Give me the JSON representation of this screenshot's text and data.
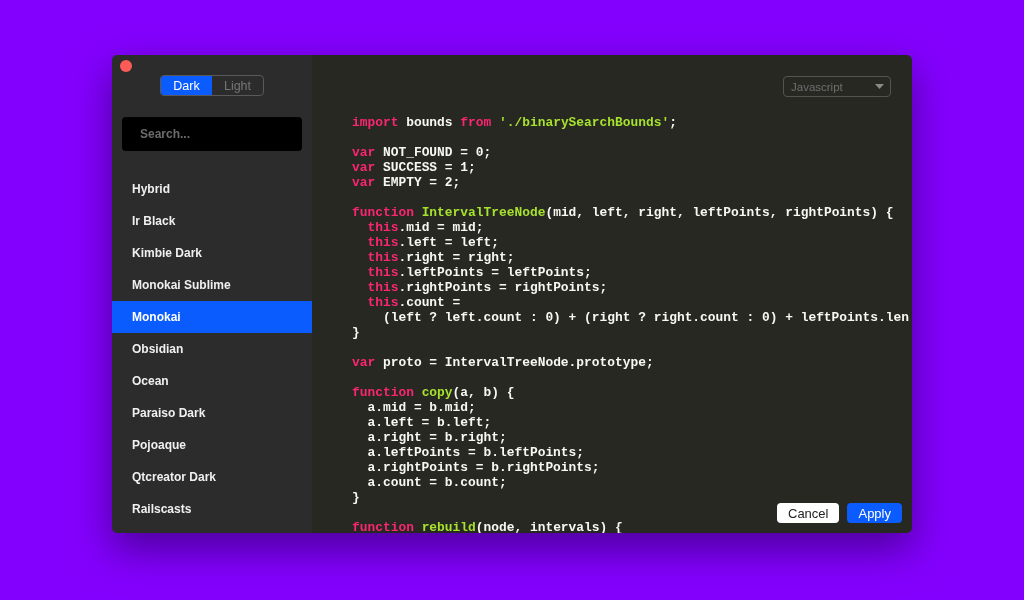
{
  "sidebar": {
    "theme_toggle": [
      {
        "label": "Dark",
        "selected": true
      },
      {
        "label": "Light",
        "selected": false
      }
    ],
    "search": {
      "placeholder": "Search..."
    },
    "items": [
      {
        "label": "Hybrid",
        "selected": false
      },
      {
        "label": "Ir Black",
        "selected": false
      },
      {
        "label": "Kimbie Dark",
        "selected": false
      },
      {
        "label": "Monokai Sublime",
        "selected": false
      },
      {
        "label": "Monokai",
        "selected": true
      },
      {
        "label": "Obsidian",
        "selected": false
      },
      {
        "label": "Ocean",
        "selected": false
      },
      {
        "label": "Paraiso Dark",
        "selected": false
      },
      {
        "label": "Pojoaque",
        "selected": false
      },
      {
        "label": "Qtcreator Dark",
        "selected": false
      },
      {
        "label": "Railscasts",
        "selected": false
      }
    ]
  },
  "editor": {
    "language_select": {
      "value": "Javascript"
    },
    "code_blocks": [
      [
        {
          "tokens": [
            {
              "kind": "keyword",
              "text": "import"
            },
            {
              "kind": "plain",
              "text": " bounds "
            },
            {
              "kind": "keyword",
              "text": "from"
            },
            {
              "kind": "string",
              "text": " './binarySearchBounds'"
            },
            {
              "kind": "plain",
              "text": ";"
            }
          ]
        }
      ],
      [
        {
          "tokens": [
            {
              "kind": "keyword",
              "text": "var"
            },
            {
              "kind": "plain",
              "text": " NOT_FOUND = 0;"
            }
          ]
        },
        {
          "tokens": [
            {
              "kind": "keyword",
              "text": "var"
            },
            {
              "kind": "plain",
              "text": " SUCCESS = 1;"
            }
          ]
        },
        {
          "tokens": [
            {
              "kind": "keyword",
              "text": "var"
            },
            {
              "kind": "plain",
              "text": " EMPTY = 2;"
            }
          ]
        }
      ],
      [
        {
          "tokens": [
            {
              "kind": "keyword",
              "text": "function"
            },
            {
              "kind": "title",
              "text": " IntervalTreeNode"
            },
            {
              "kind": "plain",
              "text": "(mid, left, right, leftPoints, rightPoints) {"
            }
          ],
          "children": [
            {
              "tokens": [
                {
                  "kind": "keyword",
                  "text": "this"
                },
                {
                  "kind": "plain",
                  "text": ".mid = mid;"
                }
              ]
            },
            {
              "tokens": [
                {
                  "kind": "keyword",
                  "text": "this"
                },
                {
                  "kind": "plain",
                  "text": ".left = left;"
                }
              ]
            },
            {
              "tokens": [
                {
                  "kind": "keyword",
                  "text": "this"
                },
                {
                  "kind": "plain",
                  "text": ".right = right;"
                }
              ]
            },
            {
              "tokens": [
                {
                  "kind": "keyword",
                  "text": "this"
                },
                {
                  "kind": "plain",
                  "text": ".leftPoints = leftPoints;"
                }
              ]
            },
            {
              "tokens": [
                {
                  "kind": "keyword",
                  "text": "this"
                },
                {
                  "kind": "plain",
                  "text": ".rightPoints = rightPoints;"
                }
              ]
            },
            {
              "tokens": [
                {
                  "kind": "keyword",
                  "text": "this"
                },
                {
                  "kind": "plain",
                  "text": ".count ="
                }
              ],
              "children": [
                {
                  "tokens": [
                    {
                      "kind": "plain",
                      "text": "(left ? left.count : 0) + (right ? right.count : 0) + leftPoints.len"
                    }
                  ]
                }
              ]
            }
          ]
        },
        {
          "tokens": [
            {
              "kind": "plain",
              "text": "}"
            }
          ]
        }
      ],
      [
        {
          "tokens": [
            {
              "kind": "keyword",
              "text": "var"
            },
            {
              "kind": "plain",
              "text": " proto = IntervalTreeNode.prototype;"
            }
          ]
        }
      ],
      [
        {
          "tokens": [
            {
              "kind": "keyword",
              "text": "function"
            },
            {
              "kind": "title",
              "text": " copy"
            },
            {
              "kind": "plain",
              "text": "(a, b) {"
            }
          ],
          "children": [
            {
              "tokens": [
                {
                  "kind": "plain",
                  "text": "a.mid = b.mid;"
                }
              ]
            },
            {
              "tokens": [
                {
                  "kind": "plain",
                  "text": "a.left = b.left;"
                }
              ]
            },
            {
              "tokens": [
                {
                  "kind": "plain",
                  "text": "a.right = b.right;"
                }
              ]
            },
            {
              "tokens": [
                {
                  "kind": "plain",
                  "text": "a.leftPoints = b.leftPoints;"
                }
              ]
            },
            {
              "tokens": [
                {
                  "kind": "plain",
                  "text": "a.rightPoints = b.rightPoints;"
                }
              ]
            },
            {
              "tokens": [
                {
                  "kind": "plain",
                  "text": "a.count = b.count;"
                }
              ]
            }
          ]
        },
        {
          "tokens": [
            {
              "kind": "plain",
              "text": "}"
            }
          ]
        }
      ],
      [
        {
          "tokens": [
            {
              "kind": "keyword",
              "text": "function"
            },
            {
              "kind": "title",
              "text": " rebuild"
            },
            {
              "kind": "plain",
              "text": "(node, intervals) {"
            }
          ]
        }
      ]
    ]
  },
  "buttons": [
    {
      "label": "Cancel",
      "kind": "secondary"
    },
    {
      "label": "Apply",
      "kind": "primary"
    }
  ]
}
